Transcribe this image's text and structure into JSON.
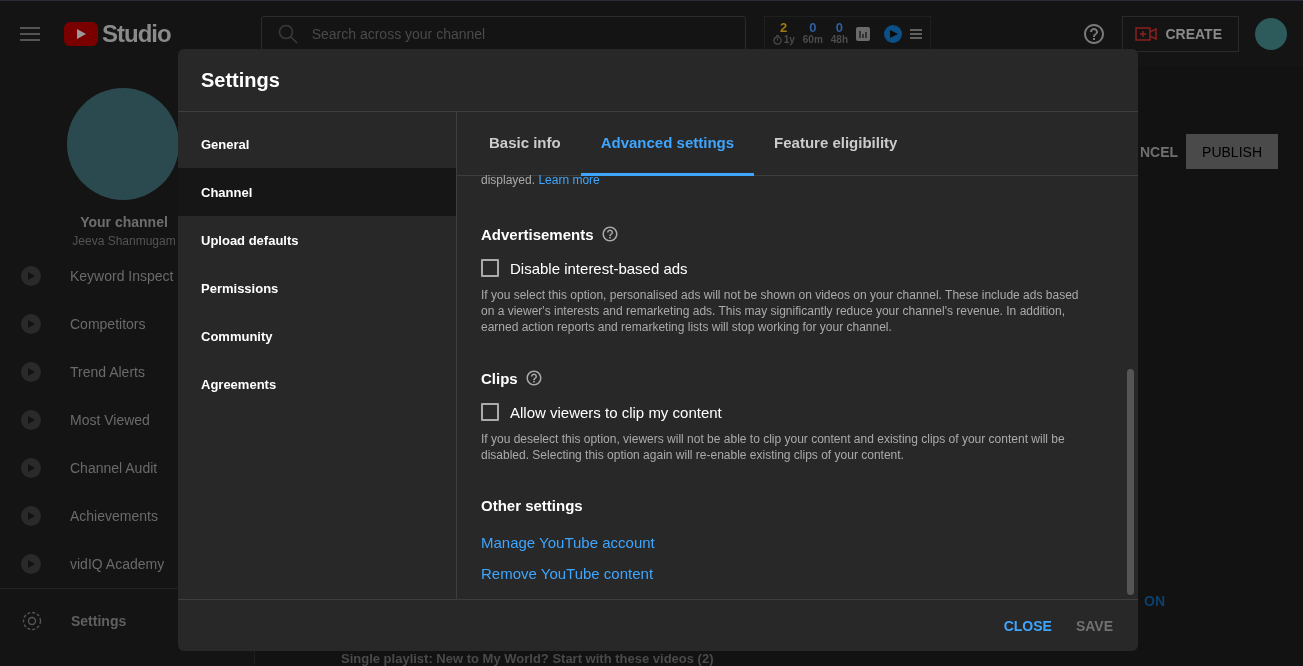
{
  "topbar": {
    "logo_text": "Studio",
    "search": {
      "placeholder": "Search across your channel"
    },
    "vidiq_stats": [
      {
        "value": "2",
        "label": "1y",
        "color": "#a07a12"
      },
      {
        "value": "0",
        "label": "60m",
        "color": "#2f5f9f"
      },
      {
        "value": "0",
        "label": "48h",
        "color": "#2f5f9f"
      }
    ],
    "create_button": "CREATE"
  },
  "sidebar": {
    "channel_title": "Your channel",
    "channel_name": "Jeeva Shanmugam",
    "items": [
      {
        "label": "Keyword Inspect"
      },
      {
        "label": "Competitors"
      },
      {
        "label": "Trend Alerts"
      },
      {
        "label": "Most Viewed"
      },
      {
        "label": "Channel Audit"
      },
      {
        "label": "Achievements"
      },
      {
        "label": "vidIQ Academy"
      }
    ],
    "settings_label": "Settings"
  },
  "page": {
    "cancel_button": "NCEL",
    "publish_button": "PUBLISH",
    "side_link": "ON",
    "playlist_text": "Single playlist: New to My World? Start with these videos (2)"
  },
  "dialog": {
    "title": "Settings",
    "nav": [
      {
        "label": "General",
        "selected": false
      },
      {
        "label": "Channel",
        "selected": true
      },
      {
        "label": "Upload defaults",
        "selected": false
      },
      {
        "label": "Permissions",
        "selected": false
      },
      {
        "label": "Community",
        "selected": false
      },
      {
        "label": "Agreements",
        "selected": false
      }
    ],
    "tabs": [
      {
        "label": "Basic info",
        "selected": false
      },
      {
        "label": "Advanced settings",
        "selected": true
      },
      {
        "label": "Feature eligibility",
        "selected": false
      }
    ],
    "intro_text": "displayed.",
    "intro_link": "Learn more",
    "sections": [
      {
        "kind": "checkbox",
        "heading": "Advertisements",
        "checkbox_label": "Disable interest-based ads",
        "checked": false,
        "description": "If you select this option, personalised ads will not be shown on videos on your channel. These include ads based on a viewer's interests and remarketing ads. This may significantly reduce your channel's revenue. In addition, earned action reports and remarketing lists will stop working for your channel."
      },
      {
        "kind": "checkbox",
        "heading": "Clips",
        "checkbox_label": "Allow viewers to clip my content",
        "checked": false,
        "description": "If you deselect this option, viewers will not be able to clip your content and existing clips of your content will be disabled. Selecting this option again will re-enable existing clips of your content."
      },
      {
        "kind": "links",
        "heading": "Other settings",
        "links": [
          "Manage YouTube account",
          "Remove YouTube content"
        ]
      }
    ],
    "buttons": [
      {
        "label": "CLOSE",
        "disabled": false
      },
      {
        "label": "SAVE",
        "disabled": true
      }
    ]
  }
}
